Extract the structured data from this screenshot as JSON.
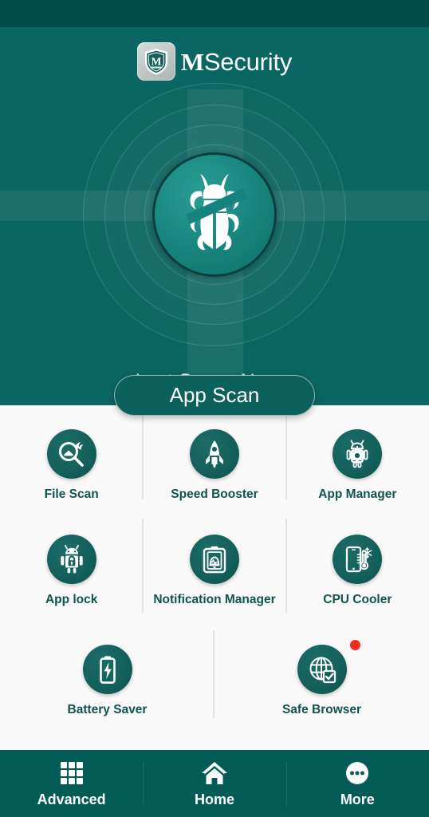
{
  "app": {
    "brand_m": "M",
    "brand_rest": "Security",
    "logo_icon": "shield-m-logo-icon",
    "accent_teal": "#0a6662",
    "dark_teal": "#024a47",
    "nav_teal": "#025b55",
    "panel_bg": "#f9f9f9",
    "label_color": "#10544f",
    "badge_red": "#f12b1f"
  },
  "hero": {
    "scan_badge_icon": "beetle-bug-icon",
    "last_scan_label": "Last Scan : Never",
    "scan_button_label": "App Scan"
  },
  "features": [
    [
      {
        "label": "File Scan",
        "icon": "magnifier-file-scan-icon",
        "badge": false
      },
      {
        "label": "Speed Booster",
        "icon": "rocket-icon",
        "badge": false
      },
      {
        "label": "App Manager",
        "icon": "android-gear-icon",
        "badge": false
      }
    ],
    [
      {
        "label": "App lock",
        "icon": "android-padlock-icon",
        "badge": false
      },
      {
        "label": "Notification Manager",
        "icon": "clipboard-bell-icon",
        "badge": false
      },
      {
        "label": "CPU Cooler",
        "icon": "phone-thermometer-snowflake-icon",
        "badge": false
      }
    ],
    [
      {
        "label": "Battery Saver",
        "icon": "battery-bolt-icon",
        "badge": false
      },
      {
        "label": "Safe Browser",
        "icon": "globe-check-icon",
        "badge": true
      }
    ]
  ],
  "navbar": [
    {
      "label": "Advanced",
      "icon": "grid-apps-icon"
    },
    {
      "label": "Home",
      "icon": "house-icon"
    },
    {
      "label": "More",
      "icon": "ellipsis-circle-icon"
    }
  ]
}
